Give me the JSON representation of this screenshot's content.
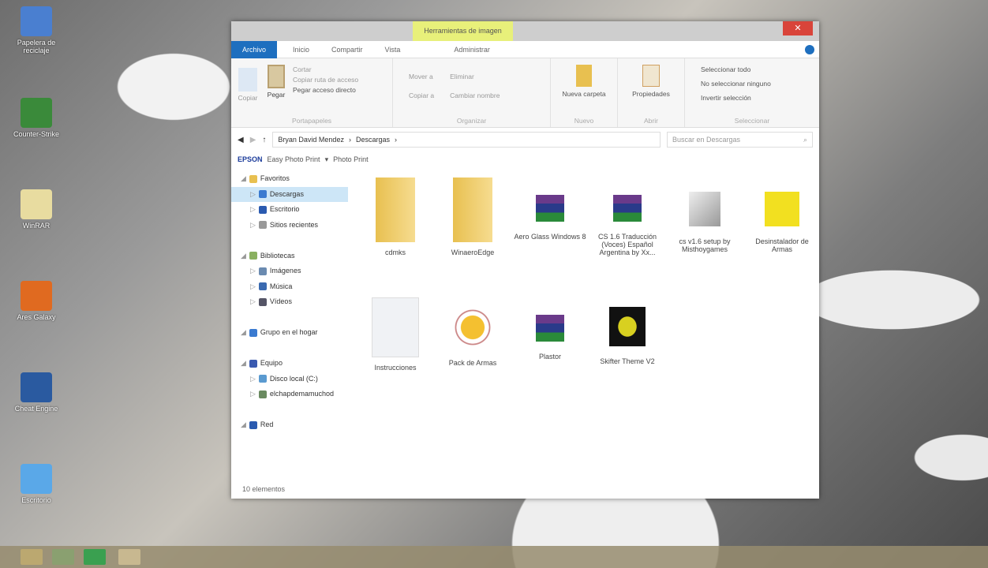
{
  "desktop": {
    "icons": [
      {
        "label": "Papelera de reciclaje",
        "color": "#4a7fd0"
      },
      {
        "label": "Counter-Strike",
        "color": "#3a8a3a"
      },
      {
        "label": "WinRAR",
        "color": "#e8dca0"
      },
      {
        "label": "Ares Galaxy",
        "color": "#e06a20"
      },
      {
        "label": "Cheat Engine",
        "color": "#2a5aa0"
      },
      {
        "label": "Escritorio",
        "color": "#5aa8e8"
      }
    ]
  },
  "window": {
    "context_tab": "Herramientas de imagen",
    "close": "✕",
    "tabs": [
      "Archivo",
      "Inicio",
      "Compartir",
      "Vista",
      "Administrar"
    ],
    "ribbon": {
      "portapapeles": {
        "label": "Portapapeles",
        "copy": "Copiar",
        "paste": "Pegar",
        "cut": "Cortar",
        "copy_path": "Copiar ruta de acceso",
        "paste_shortcut": "Pegar acceso directo"
      },
      "organizar": {
        "label": "Organizar",
        "move": "Mover a",
        "copy_to": "Copiar a",
        "delete": "Eliminar",
        "rename": "Cambiar nombre"
      },
      "nuevo": {
        "label": "Nuevo",
        "new_folder": "Nueva carpeta"
      },
      "abrir": {
        "label": "Abrir",
        "properties": "Propiedades"
      },
      "seleccionar": {
        "label": "Seleccionar",
        "all": "Seleccionar todo",
        "none": "No seleccionar ninguno",
        "invert": "Invertir selección"
      }
    },
    "address": {
      "crumbs": [
        "Bryan David Mendez",
        "Descargas"
      ],
      "search_placeholder": "Buscar en Descargas"
    },
    "epson": {
      "brand": "EPSON",
      "app": "Easy Photo Print",
      "photo": "Photo Print"
    },
    "nav": [
      {
        "label": "Favoritos",
        "level": 0,
        "color": "#e8c050"
      },
      {
        "label": "Descargas",
        "level": 1,
        "sel": true,
        "color": "#3a7ad0"
      },
      {
        "label": "Escritorio",
        "level": 1,
        "color": "#2a5ab0"
      },
      {
        "label": "Sitios recientes",
        "level": 1,
        "color": "#999"
      },
      {
        "label": "",
        "level": -1
      },
      {
        "label": "Bibliotecas",
        "level": 0,
        "color": "#8ab060"
      },
      {
        "label": "Imágenes",
        "level": 1,
        "color": "#6a8ab0"
      },
      {
        "label": "Música",
        "level": 1,
        "color": "#3a6ab0"
      },
      {
        "label": "Vídeos",
        "level": 1,
        "color": "#556"
      },
      {
        "label": "",
        "level": -1
      },
      {
        "label": "Grupo en el hogar",
        "level": 0,
        "color": "#3a7ad0"
      },
      {
        "label": "",
        "level": -1
      },
      {
        "label": "Equipo",
        "level": 0,
        "color": "#3a5ab0"
      },
      {
        "label": "Disco local (C:)",
        "level": 1,
        "color": "#5a9ad0"
      },
      {
        "label": "elchapdemamuchod",
        "level": 1,
        "color": "#6a8a60"
      },
      {
        "label": "",
        "level": -1
      },
      {
        "label": "Red",
        "level": 0,
        "color": "#2a5ab0"
      }
    ],
    "files": [
      {
        "label": "cdmks",
        "kind": "folder"
      },
      {
        "label": "WinaeroEdge",
        "kind": "folder"
      },
      {
        "label": "Aero Glass Windows 8",
        "kind": "rar"
      },
      {
        "label": "CS 1.6 Traducción (Voces) Español Argentina by Xx...",
        "kind": "rar"
      },
      {
        "label": "cs v1.6 setup by Misthoygames",
        "kind": "cs"
      },
      {
        "label": "Desinstalador de Armas",
        "kind": "yellow"
      },
      {
        "label": "Instrucciones",
        "kind": "doc"
      },
      {
        "label": "Pack de Armas",
        "kind": "pack"
      },
      {
        "label": "Plastor",
        "kind": "rar"
      },
      {
        "label": "Skifter Theme V2",
        "kind": "theme"
      }
    ],
    "status": "10 elementos"
  }
}
